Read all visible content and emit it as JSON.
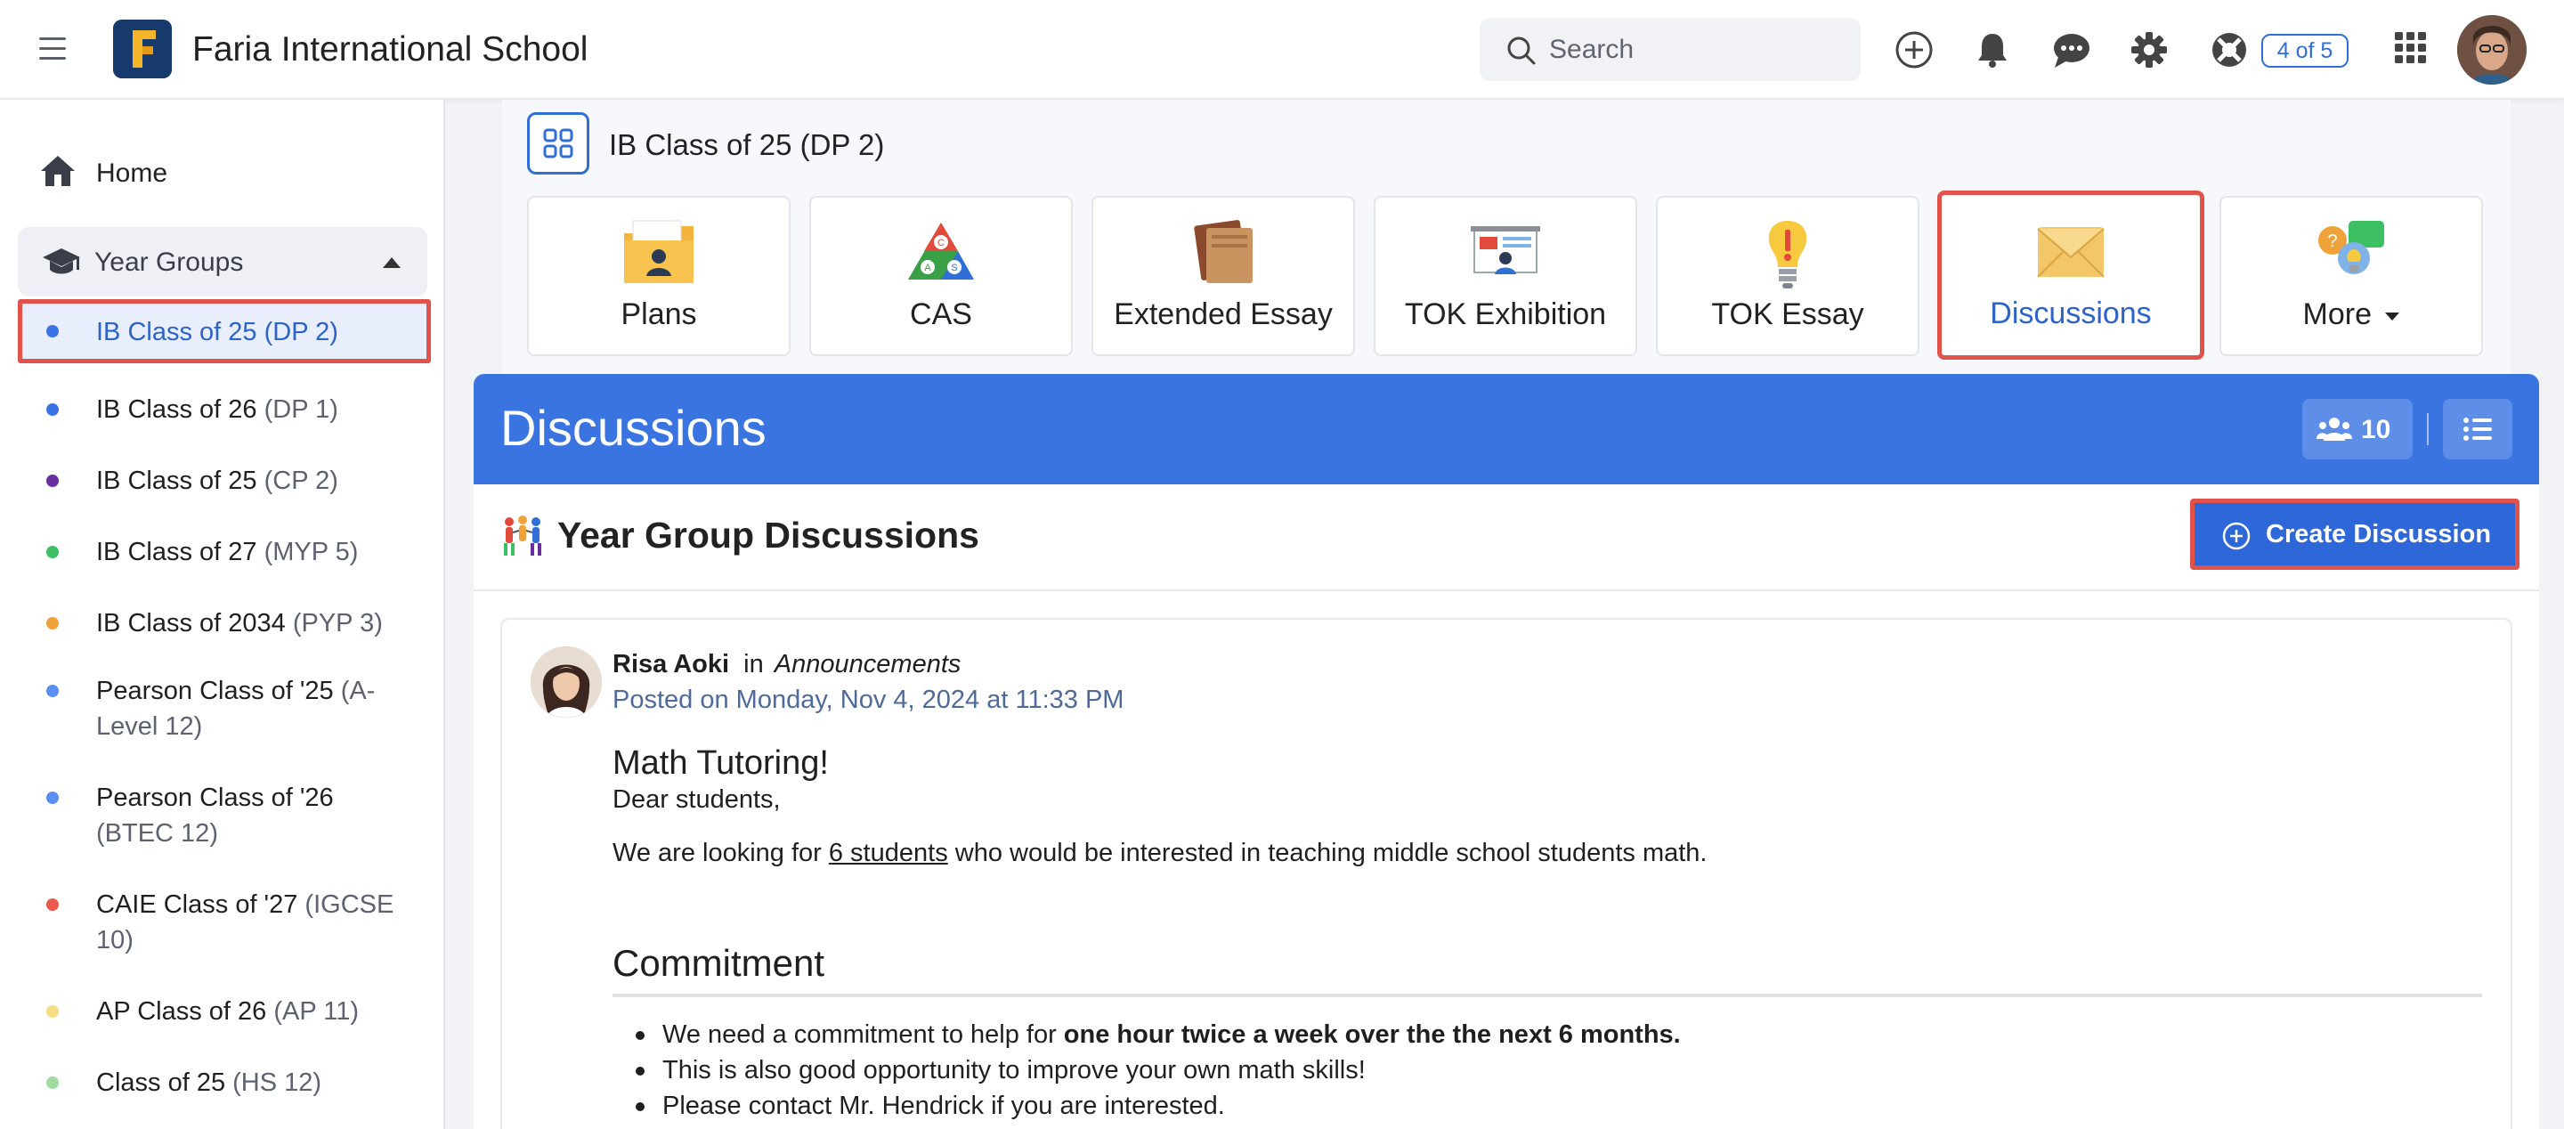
{
  "topbar": {
    "school_name": "Faria International School",
    "search_placeholder": "Search",
    "help_badge": "4 of 5"
  },
  "sidebar": {
    "home_label": "Home",
    "year_groups_label": "Year Groups",
    "items": [
      {
        "name": "IB Class of 25 ",
        "code": "(DP 2)",
        "color": "#3b73e6",
        "active": true
      },
      {
        "name": "IB Class of 26 ",
        "code": "(DP 1)",
        "color": "#3b73e6"
      },
      {
        "name": "IB Class of 25 ",
        "code": "(CP 2)",
        "color": "#6a2f9e"
      },
      {
        "name": "IB Class of 27 ",
        "code": "(MYP 5)",
        "color": "#3cc063"
      },
      {
        "name": "IB Class of 2034 ",
        "code": "(PYP 3)",
        "color": "#f0a23a"
      },
      {
        "name": "Pearson Class of '25 ",
        "code": "(A-Level 12)",
        "color": "#5a8ef0"
      },
      {
        "name": "Pearson Class of '26 ",
        "code": "(BTEC 12)",
        "color": "#5a8ef0"
      },
      {
        "name": "CAIE Class of '27 ",
        "code": "(IGCSE 10)",
        "color": "#ea5a4e"
      },
      {
        "name": "AP Class of 26 ",
        "code": "(AP 11)",
        "color": "#f5dd83"
      },
      {
        "name": "Class of 25 ",
        "code": "(HS 12)",
        "color": "#9fdca0"
      }
    ]
  },
  "class_header": {
    "title": "IB Class of 25 (DP 2)"
  },
  "tiles": [
    {
      "label": "Plans"
    },
    {
      "label": "CAS"
    },
    {
      "label": "Extended Essay"
    },
    {
      "label": "TOK Exhibition"
    },
    {
      "label": "TOK Essay"
    },
    {
      "label": "Discussions",
      "active": true
    },
    {
      "label": "More"
    }
  ],
  "discussions": {
    "banner_title": "Discussions",
    "members_count": "10",
    "section_title": "Year Group Discussions",
    "create_label": "Create Discussion"
  },
  "post": {
    "author": "Risa Aoki",
    "in_text": "in",
    "channel": "Announcements",
    "posted": "Posted on Monday, Nov 4, 2024 at 11:33 PM",
    "title": "Math Tutoring!",
    "greeting": "Dear students,",
    "body_prefix": "We are looking for ",
    "body_link": "6 students",
    "body_suffix": " who would be interested in teaching middle school students math.",
    "commitment_heading": "Commitment",
    "bullet1_prefix": "We need a commitment to help for ",
    "bullet1_bold": "one hour twice a week over the the next 6 months.",
    "bullet2": "This is also good opportunity to improve your own math skills!",
    "bullet3": "Please contact Mr. Hendrick if you are interested."
  }
}
